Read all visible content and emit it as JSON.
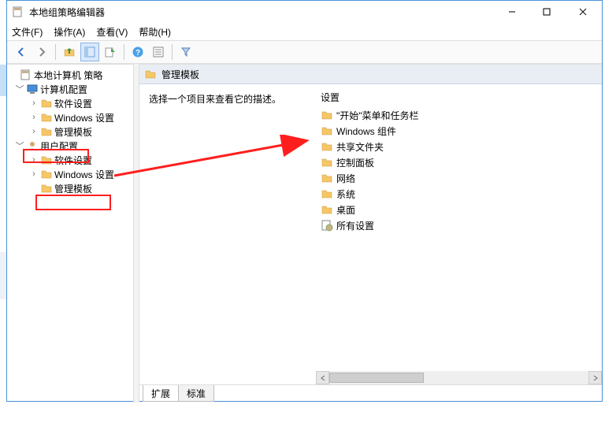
{
  "window": {
    "title": "本地组策略编辑器",
    "menus": {
      "file": "文件(F)",
      "action": "操作(A)",
      "view": "查看(V)",
      "help": "帮助(H)"
    },
    "btns": {
      "min": "–",
      "max": "☐",
      "close": "✕"
    }
  },
  "tree": {
    "root": "本地计算机 策略",
    "computer": "计算机配置",
    "computer_children": {
      "soft": "软件设置",
      "win": "Windows 设置",
      "adm": "管理模板"
    },
    "user": "用户配置",
    "user_children": {
      "soft": "软件设置",
      "win": "Windows 设置",
      "adm": "管理模板"
    }
  },
  "right": {
    "header_title": "管理模板",
    "desc_prompt": "选择一个项目来查看它的描述。",
    "col_header": "设置",
    "items": [
      "\"开始\"菜单和任务栏",
      "Windows 组件",
      "共享文件夹",
      "控制面板",
      "网络",
      "系统",
      "桌面",
      "所有设置"
    ]
  },
  "tabs": {
    "extended": "扩展",
    "standard": "标准"
  }
}
